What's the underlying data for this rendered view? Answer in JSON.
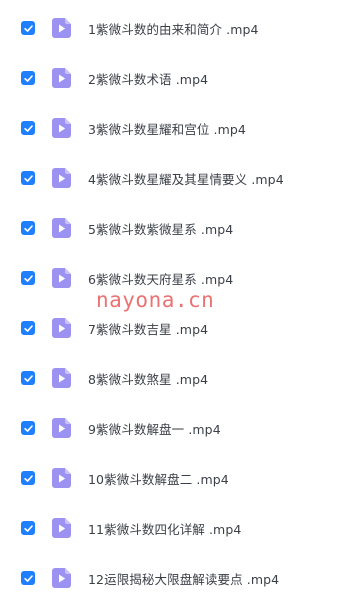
{
  "colors": {
    "checkbox": "#1f7fff",
    "file_icon": "#9b92f2",
    "file_icon_play": "#ffffff",
    "text": "#3b3f47",
    "watermark": "#e85a5a"
  },
  "icons": {
    "checkbox": "checkbox-checked-icon",
    "file": "video-file-icon"
  },
  "files": [
    {
      "name": "1紫微斗数的由来和简介 .mp4",
      "checked": true
    },
    {
      "name": "2紫微斗数术语 .mp4",
      "checked": true
    },
    {
      "name": "3紫微斗数星耀和宫位 .mp4",
      "checked": true
    },
    {
      "name": "4紫微斗数星耀及其星情要义 .mp4",
      "checked": true
    },
    {
      "name": "5紫微斗数紫微星系 .mp4",
      "checked": true
    },
    {
      "name": "6紫微斗数天府星系 .mp4",
      "checked": true
    },
    {
      "name": "7紫微斗数吉星 .mp4",
      "checked": true
    },
    {
      "name": "8紫微斗数煞星 .mp4",
      "checked": true
    },
    {
      "name": "9紫微斗数解盘一 .mp4",
      "checked": true
    },
    {
      "name": "10紫微斗数解盘二 .mp4",
      "checked": true
    },
    {
      "name": "11紫微斗数四化详解 .mp4",
      "checked": true
    },
    {
      "name": "12运限揭秘大限盘解读要点 .mp4",
      "checked": true
    }
  ],
  "watermark": "nayona.cn"
}
